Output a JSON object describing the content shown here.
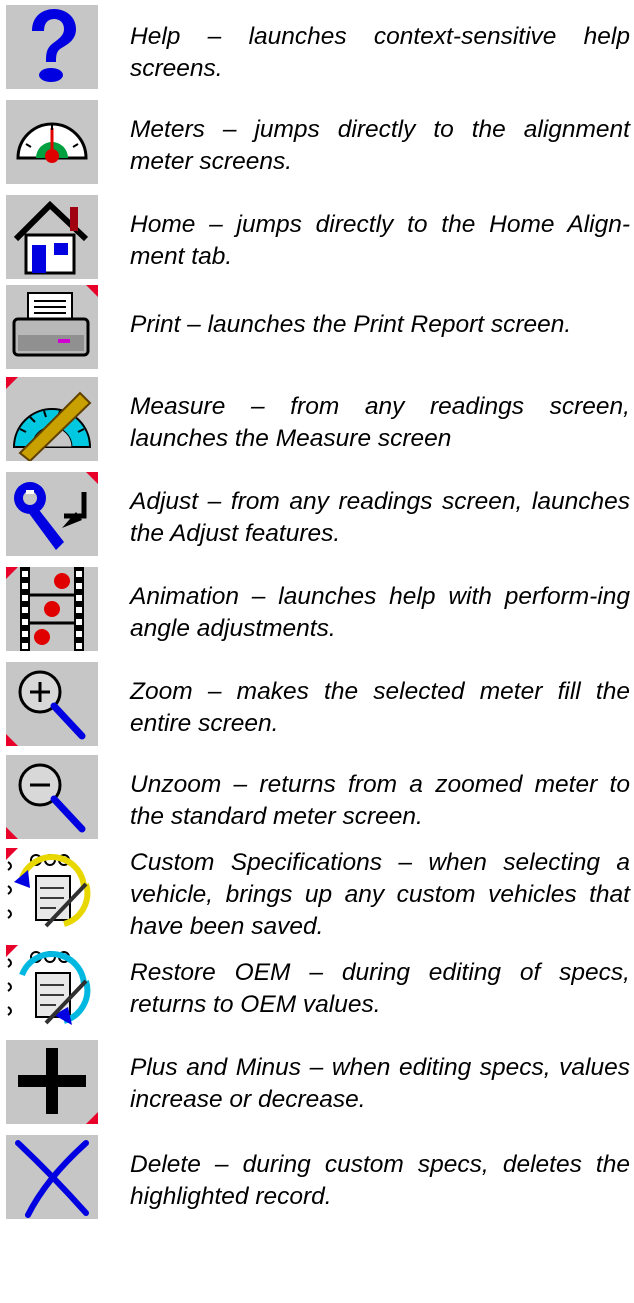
{
  "items": [
    {
      "icon": "help-question-icon",
      "text": "Help – launches context-sensitive help screens."
    },
    {
      "icon": "meters-gauge-icon",
      "text": "Meters – jumps directly to the alignment meter screens."
    },
    {
      "icon": "home-house-icon",
      "text": "Home – jumps directly to the Home Align-ment tab."
    },
    {
      "icon": "print-printer-icon",
      "text": "Print – launches the Print Report screen."
    },
    {
      "icon": "measure-protractor-icon",
      "text": "Measure – from any readings screen, launches the Measure screen"
    },
    {
      "icon": "adjust-wrench-icon",
      "text": "Adjust – from any readings screen, launches the Adjust features."
    },
    {
      "icon": "animation-filmstrip-icon",
      "text": "Animation – launches help with perform-ing angle adjustments."
    },
    {
      "icon": "zoom-in-magnifier-icon",
      "text": "Zoom – makes the selected meter fill the entire screen."
    },
    {
      "icon": "zoom-out-magnifier-icon",
      "text": "Unzoom – returns from a zoomed meter to the standard meter screen."
    },
    {
      "icon": "custom-specifications-icon",
      "text": "Custom Specifications – when selecting a vehicle, brings up any custom vehicles that have been saved."
    },
    {
      "icon": "restore-oem-icon",
      "text": "Restore OEM – during editing of specs, returns to OEM values."
    },
    {
      "icon": "plus-icon",
      "text": "Plus and Minus – when editing specs, values increase or decrease."
    },
    {
      "icon": "delete-x-icon",
      "text": "Delete – during custom specs, deletes the highlighted record."
    }
  ],
  "colors": {
    "icon_background": "#c6c6c6",
    "corner_marker": "#e8002a",
    "icon_blue": "#0000e0",
    "text": "#000000"
  }
}
